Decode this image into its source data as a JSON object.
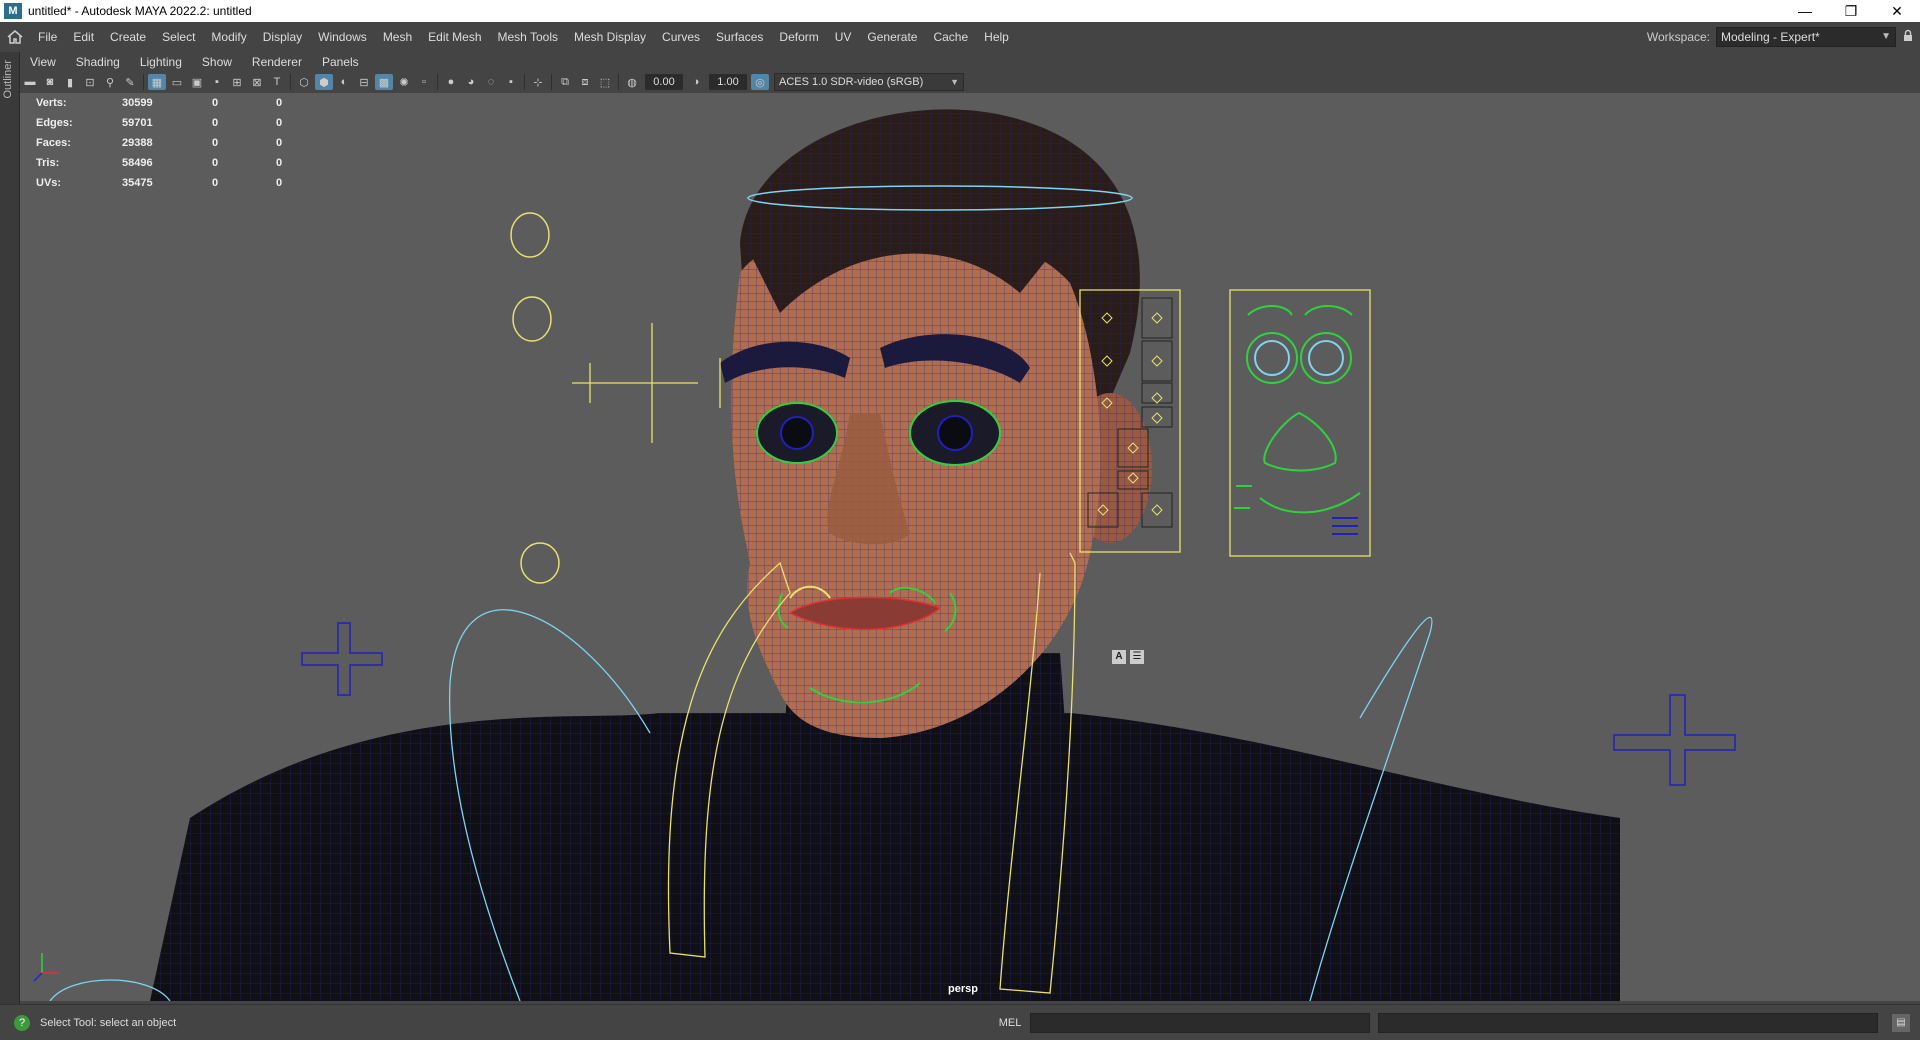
{
  "window": {
    "title": "untitled* - Autodesk MAYA 2022.2: untitled",
    "logo": "M"
  },
  "window_controls": {
    "minimize": "—",
    "restore": "❐",
    "close": "✕"
  },
  "menubar": {
    "items": [
      "File",
      "Edit",
      "Create",
      "Select",
      "Modify",
      "Display",
      "Windows",
      "Mesh",
      "Edit Mesh",
      "Mesh Tools",
      "Mesh Display",
      "Curves",
      "Surfaces",
      "Deform",
      "UV",
      "Generate",
      "Cache",
      "Help"
    ]
  },
  "workspace": {
    "label": "Workspace:",
    "value": "Modeling - Expert*",
    "lock_icon": "lock-icon"
  },
  "left_strip": {
    "label": "Outliner"
  },
  "panel_menu": {
    "items": [
      "View",
      "Shading",
      "Lighting",
      "Show",
      "Renderer",
      "Panels"
    ]
  },
  "view_toolbar": {
    "exposure": "0.00",
    "gamma": "1.00",
    "color_space": "ACES 1.0 SDR-video (sRGB)"
  },
  "hud": {
    "rows": [
      {
        "label": "Verts:",
        "value": "30599",
        "sel": "0",
        "tri": "0"
      },
      {
        "label": "Edges:",
        "value": "59701",
        "sel": "0",
        "tri": "0"
      },
      {
        "label": "Faces:",
        "value": "29388",
        "sel": "0",
        "tri": "0"
      },
      {
        "label": "Tris:",
        "value": "58496",
        "sel": "0",
        "tri": "0"
      },
      {
        "label": "UVs:",
        "value": "35475",
        "sel": "0",
        "tri": "0"
      }
    ]
  },
  "viewport": {
    "camera": "persp",
    "background": "#5c5c5c"
  },
  "facial_panel": {
    "buttons": [
      "A",
      "☰"
    ]
  },
  "status_bar": {
    "help_text": "Select Tool: select an object",
    "lang": "MEL"
  },
  "colors": {
    "wire_blue": "#2020b0",
    "rig_yellow": "#e8e070",
    "rig_green": "#30d040",
    "rig_cyan": "#7fd4ef",
    "skin": "#b06e4e"
  }
}
